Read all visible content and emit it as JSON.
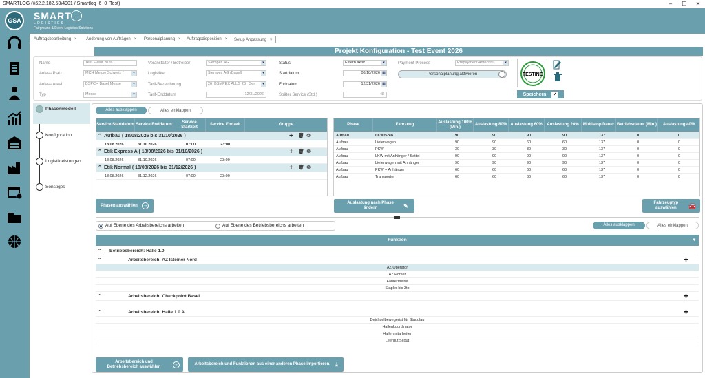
{
  "window": {
    "title": "SMARTLOG (\\\\62.2.182.53\\4901 / Smartlog_6_0_Test)"
  },
  "brand": {
    "name": "SMART",
    "sub1": "LOGISTICS",
    "sub2": "Fairground & Event Logistics Solutions",
    "avatar": "GSA"
  },
  "tabs": [
    {
      "label": "Auftragsbearbeitung"
    },
    {
      "label": "Änderung von Aufträgen"
    },
    {
      "label": "Personalplanung"
    },
    {
      "label": "Auftragsdisposition"
    },
    {
      "label": "Setup Anpassung"
    }
  ],
  "header": {
    "title": "Projekt Konfiguration - Test Event 2026"
  },
  "form": {
    "name_label": "Name",
    "name_value": "Test Event 2026",
    "anlass_platz_label": "Anlass Platz",
    "anlass_platz_value": "MCH Messe Schweiz (",
    "anlass_areal_label": "Anlass Areal",
    "anlass_areal_value": "BSPCH Basel Messe",
    "typ_label": "Typ",
    "typ_value": "Messe",
    "veranstalter_label": "Veranstalter / Betreiber",
    "veranstalter_value": "Siempex AG",
    "logistiker_label": "Logistiker",
    "logistiker_value": "Siempex AG (Basel)",
    "tarif_label": "Tarif-Bezeichnung",
    "tarif_value": "26_BSMPEX ALLG 26 _Ser",
    "tarif_enddatum_label": "Tarif-Enddatum",
    "tarif_enddatum_value": "12/31/2026",
    "status_label": "Status",
    "status_value": "Extern aktiv",
    "startdatum_label": "Startdatum",
    "startdatum_value": "08/18/2026",
    "enddatum_label": "Enddatum",
    "enddatum_value": "12/31/2026",
    "spaeter_label": "Später Service (Std.)",
    "spaeter_value": "48",
    "payment_label": "Payment Process",
    "payment_value": "Prepayment Abrechnu",
    "personal_toggle_label": "Personalplanung aktivieren",
    "stamp_text": "TESTING",
    "save_label": "Speichern"
  },
  "steps": [
    {
      "label": "Phasenmodell"
    },
    {
      "label": "Konfiguration"
    },
    {
      "label": "Logistikleistungen"
    },
    {
      "label": "Sonstiges"
    }
  ],
  "phases": {
    "expand_all": "Alles ausklappen",
    "collapse_all": "Alles einklappen",
    "columns": [
      "Service Startdatum",
      "Service Enddatum",
      "Service Startzeit",
      "Service Endzeit",
      "Gruppe"
    ],
    "groups": [
      {
        "title": "Aufbau ( 18/08/2026 bis 31/10/2026 )",
        "row": [
          "18.08.2026",
          "31.10.2026",
          "07:00",
          "23:00"
        ]
      },
      {
        "title": "Etik Express A ( 18/08/2026 bis 31/10/2026 )",
        "row": [
          "18.08.2026",
          "31.10.2026",
          "07:00",
          "23:00"
        ]
      },
      {
        "title": "Etik Normal ( 18/08/2026 bis 31/12/2026 )",
        "row": [
          "18.08.2026",
          "31.12.2026",
          "07:00",
          "23:00"
        ]
      }
    ],
    "select_button": "Phasen auswählen"
  },
  "auslastung": {
    "columns": [
      "Phase",
      "Fahrzeug",
      "Auslastung 100% (Min.)",
      "Auslastung 80%",
      "Auslastung 60%",
      "Auslastung 20%",
      "Multistop Dauer",
      "Betriebsdauer (Min.)",
      "Auslastung 40%"
    ],
    "rows": [
      [
        "Aufbau",
        "LKW/Solo",
        "90",
        "90",
        "90",
        "90",
        "137",
        "0",
        "0"
      ],
      [
        "Aufbau",
        "Lieferwagen",
        "90",
        "90",
        "60",
        "60",
        "137",
        "0",
        "0"
      ],
      [
        "Aufbau",
        "PKW",
        "30",
        "30",
        "30",
        "30",
        "137",
        "0",
        "0"
      ],
      [
        "Aufbau",
        "LKW mit Anhänger / Sattel",
        "90",
        "90",
        "90",
        "90",
        "137",
        "0",
        "0"
      ],
      [
        "Aufbau",
        "Lieferwagen mit Anhänger",
        "90",
        "90",
        "90",
        "90",
        "137",
        "0",
        "0"
      ],
      [
        "Aufbau",
        "PKW + Anhänger",
        "60",
        "60",
        "60",
        "60",
        "137",
        "0",
        "0"
      ],
      [
        "Aufbau",
        "Transporter",
        "60",
        "60",
        "60",
        "60",
        "137",
        "0",
        "0"
      ]
    ],
    "phase_button": "Auslastung nach Phase ändern",
    "vehicle_button": "Fahrzeugtyp auswählen"
  },
  "bereich": {
    "radio1": "Auf Ebene des Arbeitsbereichs arbeiten",
    "radio2": "Auf Ebene des Betriebsbereichs arbeiten",
    "expand_all": "Alles ausklappen",
    "collapse_all": "Alles einklappen",
    "column": "Funktion",
    "betriebsbereich": "Betriebsbereich: Halle 1.0",
    "areas": [
      {
        "title": "Arbeitsbereich: AZ Isteiner Nord",
        "items": [
          "AZ Operator",
          "AZ Portier",
          "Fahrermeise",
          "Stapler bis 3to"
        ]
      },
      {
        "title": "Arbeitsbereich: Checkpoint Basel",
        "items": []
      },
      {
        "title": "Arbeitsbereich: Halle 1.0 A",
        "items": [
          "Deichselbewegerist für Staudlau",
          "Hallenkoordinator",
          "Hallenmitarbeiter",
          "Leergut Scout"
        ]
      }
    ],
    "select_button": "Arbeitsbereich und Betriebsbereich auswählen",
    "import_button": "Arbeitsbereich und Funktionen aus einer anderen Phase importieren."
  },
  "colors": {
    "accent": "#6a9fad",
    "highlight": "#d8eaee"
  }
}
